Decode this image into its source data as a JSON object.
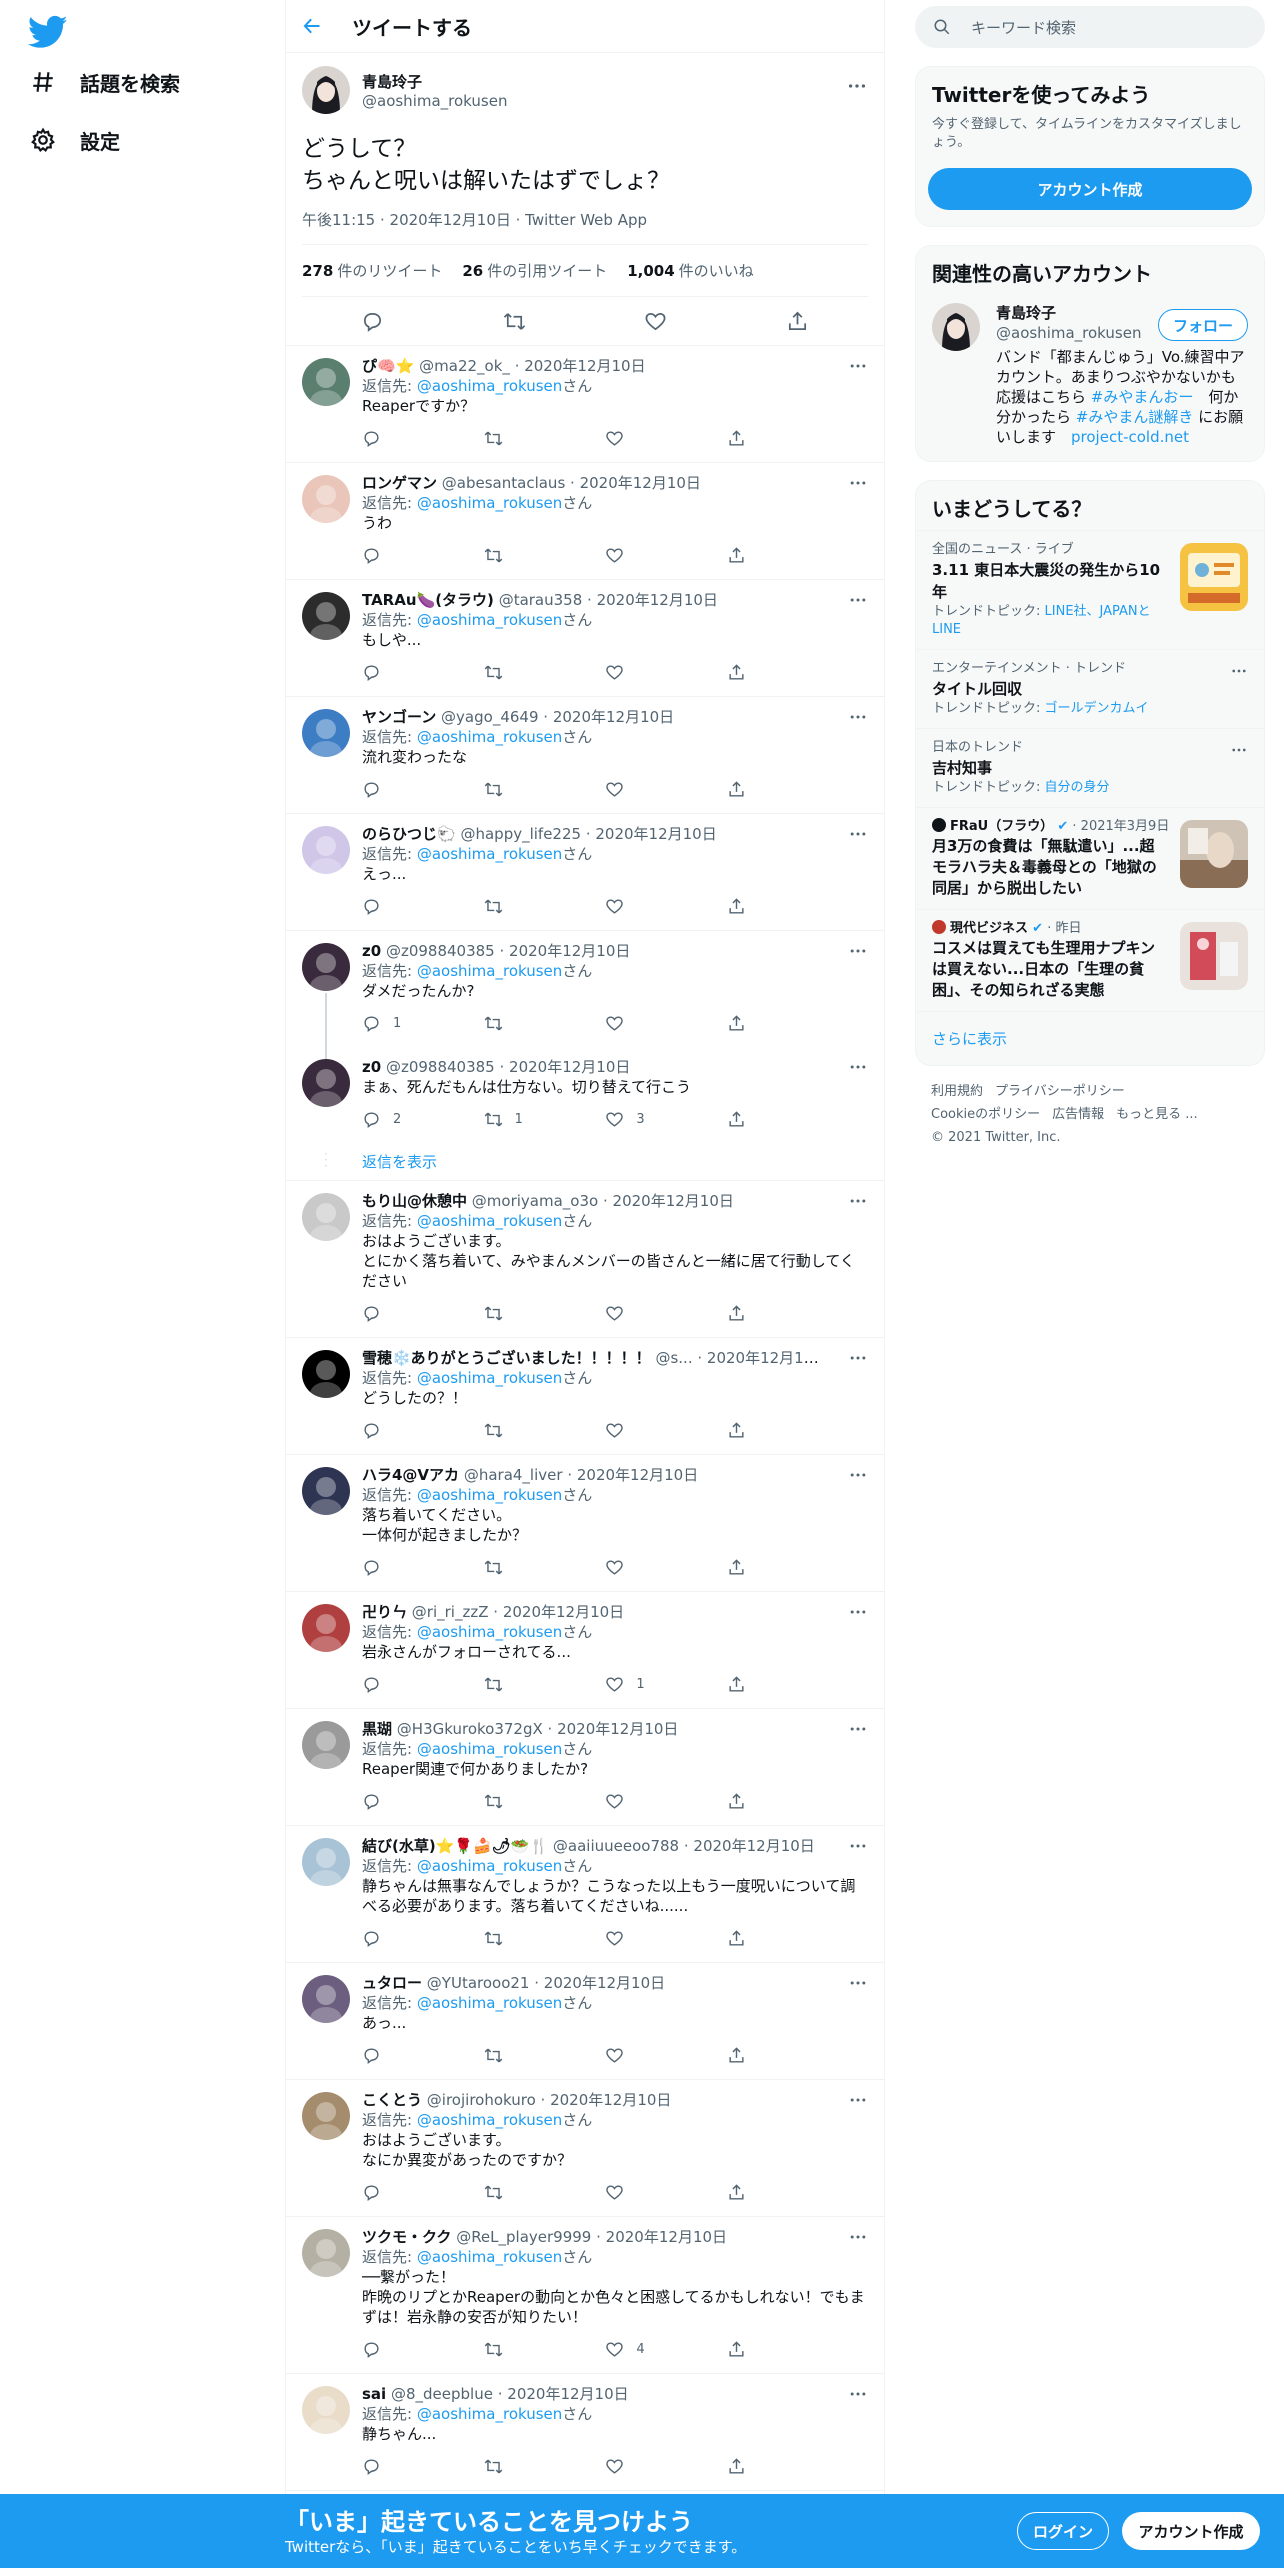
{
  "nav": {
    "explore": "話題を検索",
    "settings": "設定"
  },
  "header": {
    "title": "ツイートする"
  },
  "main_tweet": {
    "name": "青島玲子",
    "handle": "@aoshima_rokusen",
    "text_line1": "どうして？",
    "text_line2": "ちゃんと呪いは解いたはずでしょ？",
    "meta": "午後11:15 · 2020年12月10日 · Twitter Web App",
    "retweets_count": "278",
    "retweets_label": "件のリツイート",
    "quotes_count": "26",
    "quotes_label": "件の引用ツイート",
    "likes_count": "1,004",
    "likes_label": "件のいいね"
  },
  "reply_prefix": "返信先: ",
  "reply_to": "@aoshima_rokusen",
  "reply_suffix": "さん",
  "replies": [
    {
      "name": "ぴ🧠⭐",
      "handle": "@ma22_ok_",
      "date": "· 2020年12月10日",
      "body": "Reaperですか？",
      "replies": "",
      "retweets": "",
      "likes": "",
      "show_replyto": true
    },
    {
      "name": "ロンゲマン",
      "handle": "@abesantaclaus",
      "date": "· 2020年12月10日",
      "body": "うわ",
      "replies": "",
      "retweets": "",
      "likes": "",
      "show_replyto": true
    },
    {
      "name": "TARAu🍆(タラウ)",
      "handle": "@tarau358",
      "date": "· 2020年12月10日",
      "body": "もしや...",
      "replies": "",
      "retweets": "",
      "likes": "",
      "show_replyto": true
    },
    {
      "name": "ヤンゴーン",
      "handle": "@yago_4649",
      "date": "· 2020年12月10日",
      "body": "流れ変わったな",
      "replies": "",
      "retweets": "",
      "likes": "",
      "show_replyto": true
    },
    {
      "name": "のらひつじ🐑",
      "handle": "@happy_life225",
      "date": "· 2020年12月10日",
      "body": "えっ...",
      "replies": "",
      "retweets": "",
      "likes": "",
      "show_replyto": true
    },
    {
      "name": "z0",
      "handle": "@z098840385",
      "date": "· 2020年12月10日",
      "body": "ダメだったんか?",
      "replies": "1",
      "retweets": "",
      "likes": "",
      "show_replyto": true
    },
    {
      "name": "z0",
      "handle": "@z098840385",
      "date": "· 2020年12月10日",
      "body": "まぁ、死んだもんは仕方ない。切り替えて行こう",
      "replies": "2",
      "retweets": "1",
      "likes": "3",
      "show_replyto": false
    },
    {
      "name": "もり山@休憩中",
      "handle": "@moriyama_o3o",
      "date": "· 2020年12月10日",
      "body": "おはようございます。\nとにかく落ち着いて、みやまんメンバーの皆さんと一緒に居て行動してください",
      "replies": "",
      "retweets": "",
      "likes": "",
      "show_replyto": true
    },
    {
      "name": "雪穂❄️ありがとうございました！！！！！",
      "handle": "@s...",
      "date": "· 2020年12月10日",
      "body": "どうしたの？！",
      "replies": "",
      "retweets": "",
      "likes": "",
      "show_replyto": true
    },
    {
      "name": "ハラ4@Vアカ",
      "handle": "@hara4_liver",
      "date": "· 2020年12月10日",
      "body": "落ち着いてください。\n一体何が起きましたか？",
      "replies": "",
      "retweets": "",
      "likes": "",
      "show_replyto": true
    },
    {
      "name": "卍りㄣ",
      "handle": "@ri_ri_zzZ",
      "date": "· 2020年12月10日",
      "body": "岩永さんがフォローされてる...",
      "replies": "",
      "retweets": "",
      "likes": "1",
      "show_replyto": true
    },
    {
      "name": "黒瑚",
      "handle": "@H3Gkuroko372gX",
      "date": "· 2020年12月10日",
      "body": "Reaper関連で何かありましたか?",
      "replies": "",
      "retweets": "",
      "likes": "",
      "show_replyto": true
    },
    {
      "name": "結び(水草)⭐🌹🍰🌶🥗🍴",
      "handle": "@aaiiuueeoo788",
      "date": "· 2020年12月10日",
      "body": "静ちゃんは無事なんでしょうか？こうなった以上もう一度呪いについて調べる必要があります。落ち着いてくださいね......",
      "replies": "",
      "retweets": "",
      "likes": "",
      "show_replyto": true
    },
    {
      "name": "ュタロー",
      "handle": "@YUtarooo21",
      "date": "· 2020年12月10日",
      "body": "あっ...",
      "replies": "",
      "retweets": "",
      "likes": "",
      "show_replyto": true
    },
    {
      "name": "こくとう",
      "handle": "@irojirohokuro",
      "date": "· 2020年12月10日",
      "body": "おはようございます。\nなにか異変があったのですか？",
      "replies": "",
      "retweets": "",
      "likes": "",
      "show_replyto": true
    },
    {
      "name": "ツクモ・クク",
      "handle": "@ReL_player9999",
      "date": "· 2020年12月10日",
      "body": "──繋がった！\n昨晩のリプとかReaperの動向とか色々と困惑してるかもしれない！でもまずは！岩永静の安否が知りたい！",
      "replies": "",
      "retweets": "",
      "likes": "4",
      "show_replyto": true
    },
    {
      "name": "sai",
      "handle": "@8_deepblue",
      "date": "· 2020年12月10日",
      "body": "静ちゃん...",
      "replies": "",
      "retweets": "",
      "likes": "",
      "show_replyto": true
    }
  ],
  "show_replies": "返信を表示",
  "search": {
    "placeholder": "キーワード検索"
  },
  "signup": {
    "title": "Twitterを使ってみよう",
    "subtitle": "今すぐ登録して、タイムラインをカスタマイズしましょう。",
    "button": "アカウント作成"
  },
  "related": {
    "title": "関連性の高いアカウント",
    "name": "青島玲子",
    "handle": "@aoshima_rokusen",
    "follow": "フォロー",
    "bio_1": "バンド「都まんじゅう」Vo.練習中アカウント。あまりつぶやかないかも 応援はこちら ",
    "bio_tag1": "#みやまんおー",
    "bio_2": "　何か分かったら ",
    "bio_tag2": "#みやまん謎解き",
    "bio_3": " にお願いします　",
    "bio_link": "project-cold.net"
  },
  "trends": {
    "title": "いまどうしてる？",
    "items": [
      {
        "meta": "全国のニュース · ライブ",
        "title": "3.11 東日本大震災の発生から10年",
        "sub_prefix": "トレンドトピック: ",
        "sub_link": "LINE社、JAPANとLINE"
      },
      {
        "meta": "エンターテインメント · トレンド",
        "title": "タイトル回収",
        "sub_prefix": "トレンドトピック: ",
        "sub_link": "ゴールデンカムイ"
      },
      {
        "meta": "日本のトレンド",
        "title": "吉村知事",
        "sub_prefix": "トレンドトピック: ",
        "sub_link": "自分の身分"
      }
    ],
    "news": [
      {
        "source": "FRaU（フラウ）",
        "time": "· 2021年3月9日",
        "title": "月3万の食費は「無駄遣い」...超モラハラ夫＆毒義母との「地獄の同居」から脱出したい"
      },
      {
        "source": "現代ビジネス",
        "time": "· 昨日",
        "title": "コスメは買えても生理用ナプキンは買えない...日本の「生理の貧困」、その知られざる実態"
      }
    ],
    "show_more": "さらに表示"
  },
  "footer": {
    "terms": "利用規約",
    "privacy": "プライバシーポリシー",
    "cookie": "Cookieのポリシー",
    "ads": "広告情報",
    "more": "もっと見る ...",
    "copyright": "© 2021 Twitter, Inc."
  },
  "bottom_bar": {
    "title": "「いま」起きていることを見つけよう",
    "subtitle": "Twitterなら、「いま」起きていることをいち早くチェックできます。",
    "login": "ログイン",
    "signup": "アカウント作成"
  },
  "colors": {
    "accent": "#1d9bf0",
    "text": "#0f1419",
    "muted": "#536471",
    "border": "#eff3f4"
  }
}
